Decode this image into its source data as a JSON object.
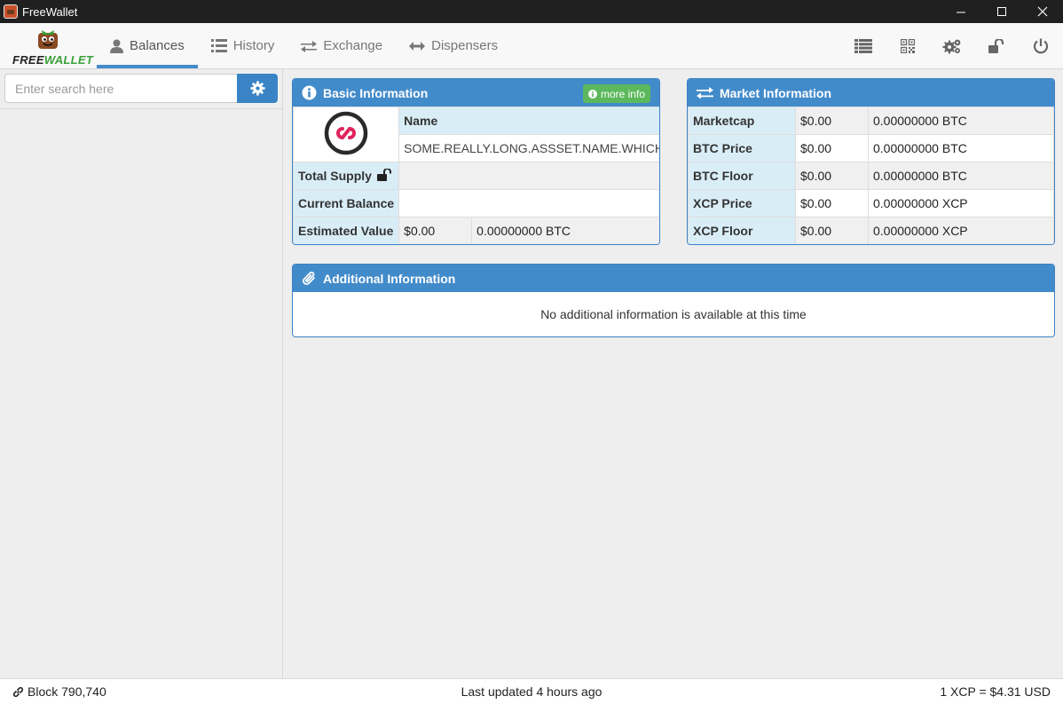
{
  "window": {
    "title": "FreeWallet"
  },
  "logo": {
    "free": "FREE",
    "wallet": "WALLET"
  },
  "nav": {
    "tabs": [
      {
        "label": "Balances",
        "icon": "user-icon",
        "active": true
      },
      {
        "label": "History",
        "icon": "list-icon"
      },
      {
        "label": "Exchange",
        "icon": "exchange-arrows-icon"
      },
      {
        "label": "Dispensers",
        "icon": "double-arrow-icon"
      }
    ],
    "right_icons": [
      "list-view-icon",
      "qr-code-icon",
      "settings-gears-icon",
      "unlock-icon",
      "power-icon"
    ]
  },
  "search": {
    "placeholder": "Enter search here"
  },
  "basic_info": {
    "title": "Basic Information",
    "more_info": "more info",
    "name_label": "Name",
    "name_value": "SOME.REALLY.LONG.ASSSET.NAME.WHICH.S...",
    "total_supply_label": "Total Supply",
    "total_supply_value": "",
    "current_balance_label": "Current Balance",
    "current_balance_value": "",
    "estimated_value_label": "Estimated Value",
    "estimated_value_usd": "$0.00",
    "estimated_value_btc": "0.00000000 BTC"
  },
  "market_info": {
    "title": "Market Information",
    "rows": [
      {
        "label": "Marketcap",
        "usd": "$0.00",
        "crypto": "0.00000000 BTC"
      },
      {
        "label": "BTC Price",
        "usd": "$0.00",
        "crypto": "0.00000000 BTC"
      },
      {
        "label": "BTC Floor",
        "usd": "$0.00",
        "crypto": "0.00000000 BTC"
      },
      {
        "label": "XCP Price",
        "usd": "$0.00",
        "crypto": "0.00000000 XCP"
      },
      {
        "label": "XCP Floor",
        "usd": "$0.00",
        "crypto": "0.00000000 XCP"
      }
    ]
  },
  "additional_info": {
    "title": "Additional Information",
    "message": "No additional information is available at this time"
  },
  "status": {
    "block": "Block 790,740",
    "updated": "Last updated 4 hours ago",
    "rate": "1 XCP = $4.31 USD"
  },
  "colors": {
    "primary": "#428bca",
    "success": "#5cb85c",
    "label_bg": "#d9edf7",
    "asset_icon": "#e0245e"
  }
}
